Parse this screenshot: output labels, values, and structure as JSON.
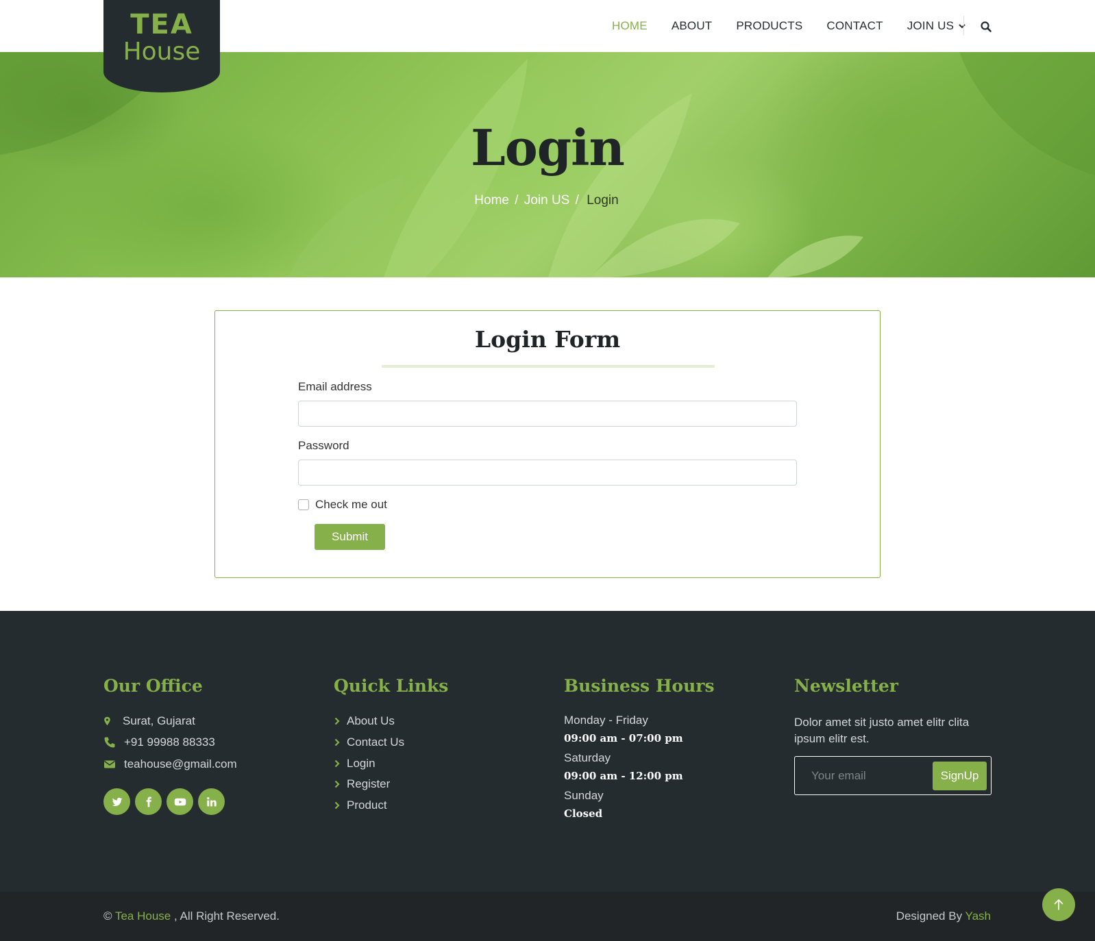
{
  "brand": {
    "logo_line1": "TEA",
    "logo_line2": "House",
    "accent_color": "#86b049",
    "dark_color": "#252c2f"
  },
  "nav": {
    "items": [
      {
        "label": "HOME",
        "active": true
      },
      {
        "label": "ABOUT"
      },
      {
        "label": "PRODUCTS"
      },
      {
        "label": "CONTACT"
      },
      {
        "label": "JOIN US",
        "dropdown": true
      }
    ],
    "search_icon": "search-icon"
  },
  "hero": {
    "title": "Login",
    "breadcrumb": [
      "Home",
      "Join US",
      "Login"
    ],
    "separator": "/"
  },
  "form": {
    "title": "Login Form",
    "email_label": "Email address",
    "email_value": "",
    "password_label": "Password",
    "password_value": "",
    "check_label": "Check me out",
    "checked": false,
    "submit_label": "Submit"
  },
  "footer": {
    "office": {
      "title": "Our Office",
      "address": "Surat, Gujarat",
      "phone": "+91 99988 88333",
      "email": "teahouse@gmail.com",
      "socials": [
        "twitter-icon",
        "facebook-icon",
        "youtube-icon",
        "linkedin-icon"
      ]
    },
    "links": {
      "title": "Quick Links",
      "items": [
        "About Us",
        "Contact Us",
        "Login",
        "Register",
        "Product"
      ]
    },
    "hours": {
      "title": "Business Hours",
      "rows": [
        {
          "day": "Monday - Friday",
          "time": "09:00 am - 07:00 pm"
        },
        {
          "day": "Saturday",
          "time": "09:00 am - 12:00 pm"
        },
        {
          "day": "Sunday",
          "time": "Closed"
        }
      ]
    },
    "newsletter": {
      "title": "Newsletter",
      "text": "Dolor amet sit justo amet elitr clita ipsum elitr est.",
      "placeholder": "Your email",
      "button_label": "SignUp"
    }
  },
  "bottom": {
    "copyright_prefix": "©",
    "copyright_brand": "Tea House",
    "copyright_suffix": ", All Right Reserved.",
    "designed_prefix": "Designed By",
    "designed_by": "Yash"
  }
}
